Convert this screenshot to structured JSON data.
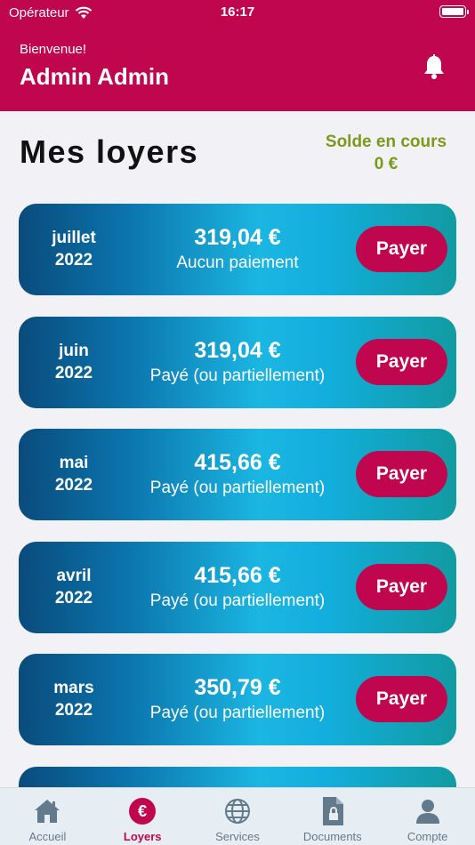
{
  "status_bar": {
    "carrier": "Opérateur",
    "time": "16:17"
  },
  "header": {
    "welcome": "Bienvenue!",
    "user_name": "Admin Admin",
    "bell_icon": "bell-icon"
  },
  "page": {
    "title": "Mes loyers",
    "balance_label": "Solde en cours",
    "balance_value": "0 €"
  },
  "rents": [
    {
      "month": "juillet",
      "year": "2022",
      "amount": "319,04 €",
      "status": "Aucun paiement",
      "button": "Payer"
    },
    {
      "month": "juin",
      "year": "2022",
      "amount": "319,04 €",
      "status": "Payé (ou partiellement)",
      "button": "Payer"
    },
    {
      "month": "mai",
      "year": "2022",
      "amount": "415,66 €",
      "status": "Payé (ou partiellement)",
      "button": "Payer"
    },
    {
      "month": "avril",
      "year": "2022",
      "amount": "415,66 €",
      "status": "Payé (ou partiellement)",
      "button": "Payer"
    },
    {
      "month": "mars",
      "year": "2022",
      "amount": "350,79 €",
      "status": "Payé (ou partiellement)",
      "button": "Payer"
    }
  ],
  "tabs": [
    {
      "label": "Accueil",
      "icon": "home-icon",
      "active": false
    },
    {
      "label": "Loyers",
      "icon": "euro-icon",
      "active": true
    },
    {
      "label": "Services",
      "icon": "globe-icon",
      "active": false
    },
    {
      "label": "Documents",
      "icon": "document-lock-icon",
      "active": false
    },
    {
      "label": "Compte",
      "icon": "person-icon",
      "active": false
    }
  ],
  "colors": {
    "brand": "#c0064e",
    "balance": "#7a9a1a",
    "tab_inactive": "#637a8c"
  }
}
